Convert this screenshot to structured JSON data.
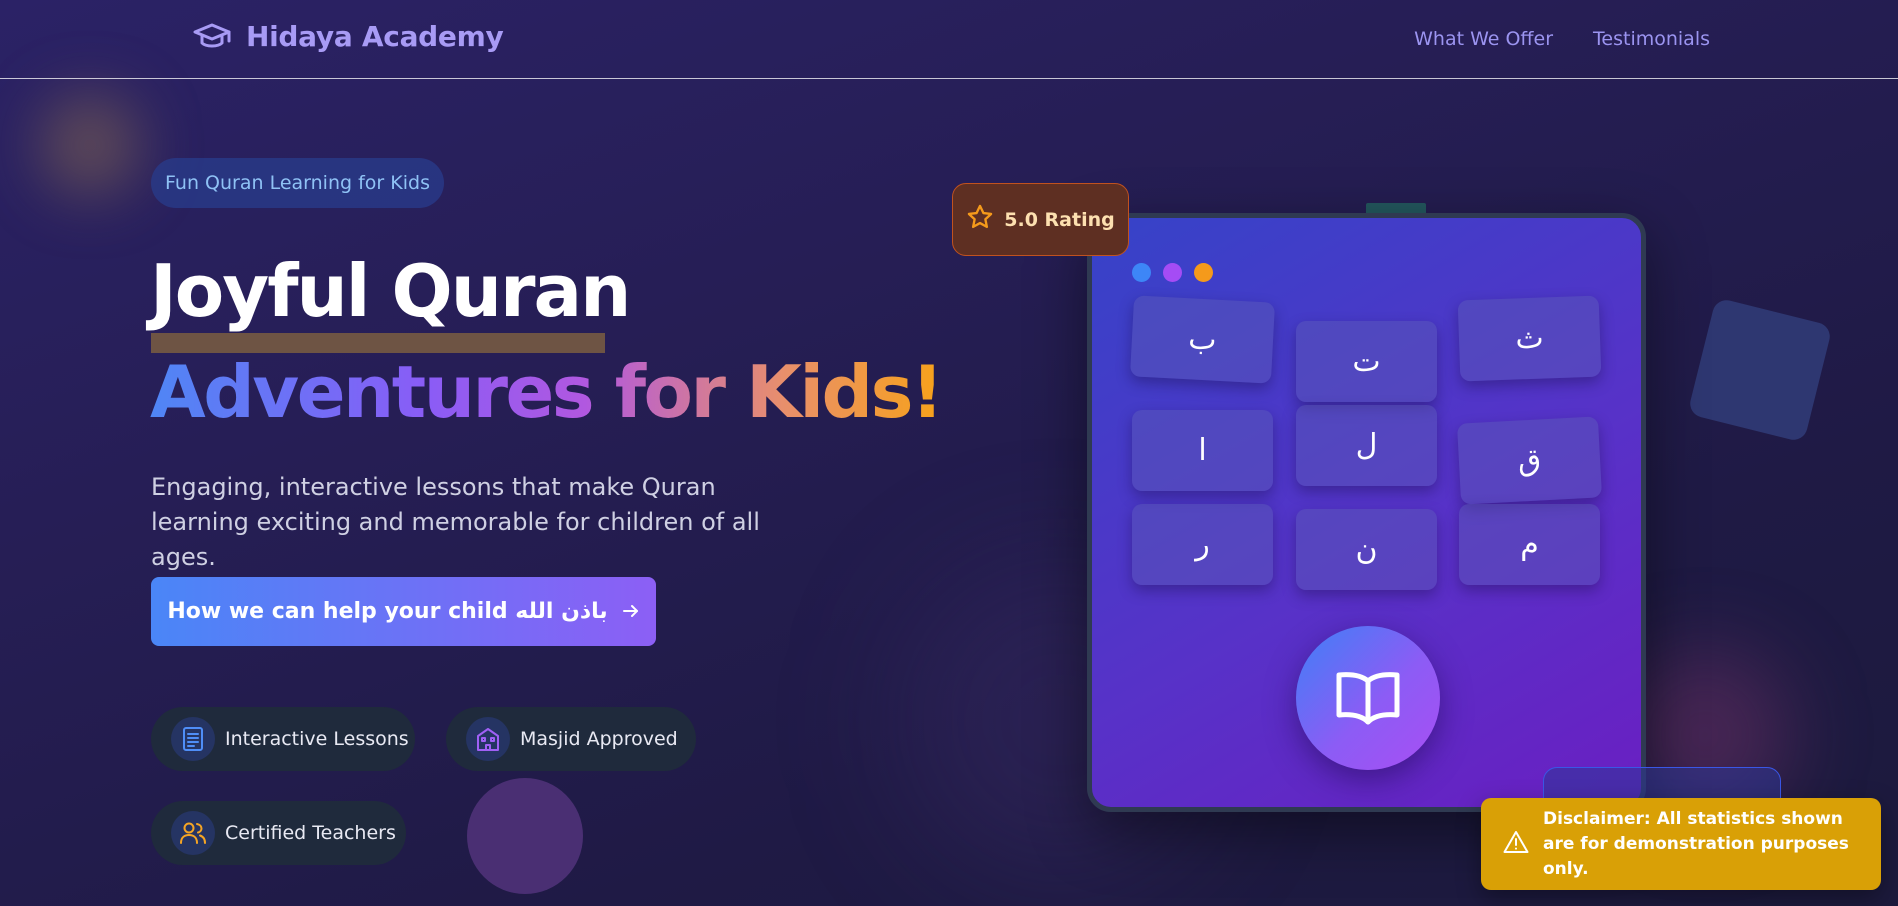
{
  "brand": {
    "name": "Hidaya Academy",
    "icon": "graduation-cap-icon"
  },
  "nav": {
    "links": [
      "What We Offer",
      "Testimonials"
    ]
  },
  "hero": {
    "tag": "Fun Quran Learning for Kids",
    "title_line1": "Joyful Quran",
    "title_line2": "Adventures for Kids!",
    "subtitle": "Engaging, interactive lessons that make Quran learning exciting and memorable for children of all ages.",
    "cta_label": "How we can help your child باذن الله",
    "cta_icon": "arrow-right-icon"
  },
  "features": [
    {
      "label": "Interactive Lessons",
      "icon": "document-icon",
      "color": "#4f8ef7"
    },
    {
      "label": "Masjid Approved",
      "icon": "masjid-icon",
      "color": "#a060f5"
    },
    {
      "label": "Certified Teachers",
      "icon": "users-icon",
      "color": "#f5a524"
    }
  ],
  "tablet": {
    "dot_colors": [
      "#3d86f7",
      "#a54cf5",
      "#f59a1b"
    ],
    "letters": [
      "ب",
      "ت",
      "ث",
      "ا",
      "ل",
      "ق",
      "ر",
      "ن",
      "م"
    ],
    "center_icon": "open-book-icon"
  },
  "rating": {
    "label": "5.0 Rating",
    "icon": "star-icon"
  },
  "disclaimer": {
    "text": "Disclaimer: All statistics shown are for demonstration purposes only.",
    "icon": "warning-icon"
  }
}
